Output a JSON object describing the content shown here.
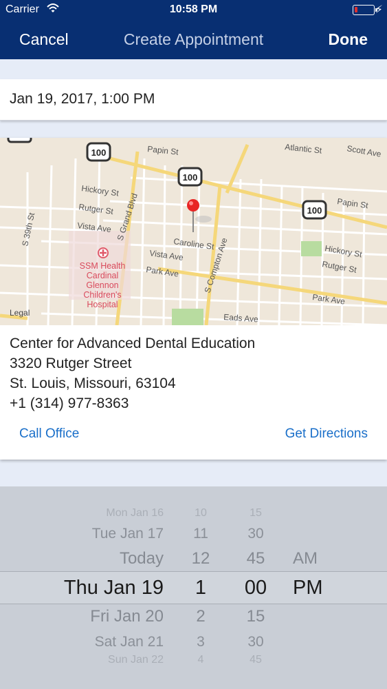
{
  "status_bar": {
    "carrier": "Carrier",
    "time": "10:58 PM"
  },
  "nav": {
    "cancel_label": "Cancel",
    "title": "Create Appointment",
    "done_label": "Done"
  },
  "date_field": {
    "value": "Jan 19, 2017, 1:00 PM"
  },
  "map": {
    "legal_label": "Legal",
    "route_shields": [
      "100",
      "100",
      "100"
    ],
    "streets": [
      "Papin St",
      "Atlantic St",
      "Scott Ave",
      "Hickory St",
      "Rutger St",
      "Vista Ave",
      "S 39th St",
      "S Grand Blvd",
      "Caroline St",
      "Vista Ave",
      "Park Ave",
      "S Compton Ave",
      "Papin St",
      "Hickory St",
      "Rutger St",
      "Park Ave",
      "Eads Ave"
    ],
    "poi_name": "SSM Health Cardinal Glennon Children's Hospital",
    "poi_lines": [
      "SSM Health",
      "Cardinal",
      "Glennon",
      "Children's",
      "Hospital"
    ],
    "colors": {
      "land": "#efe7da",
      "road": "#ffffff",
      "highway": "#f5d77a",
      "park": "#b8dca0",
      "pin": "#e82525",
      "poi": "#e05a6a"
    }
  },
  "office": {
    "name": "Center for Advanced Dental Education",
    "street": "3320 Rutger Street",
    "city_line": "St. Louis, Missouri, 63104",
    "phone": "+1 (314) 977-8363"
  },
  "actions": {
    "call_label": "Call Office",
    "directions_label": "Get Directions"
  },
  "picker": {
    "rows": [
      {
        "day": "Mon Jan 16",
        "hour": "10",
        "minute": "15",
        "ampm": ""
      },
      {
        "day": "Tue Jan 17",
        "hour": "11",
        "minute": "30",
        "ampm": ""
      },
      {
        "day": "Today",
        "hour": "12",
        "minute": "45",
        "ampm": "AM"
      },
      {
        "day": "Thu Jan 19",
        "hour": "1",
        "minute": "00",
        "ampm": "PM"
      },
      {
        "day": "Fri Jan 20",
        "hour": "2",
        "minute": "15",
        "ampm": ""
      },
      {
        "day": "Sat Jan 21",
        "hour": "3",
        "minute": "30",
        "ampm": ""
      },
      {
        "day": "Sun Jan 22",
        "hour": "4",
        "minute": "45",
        "ampm": ""
      }
    ]
  },
  "colors": {
    "nav_background": "#082f72",
    "link": "#1a6fc9",
    "page_background": "#e6ecf7",
    "picker_background": "#c9ced6"
  }
}
